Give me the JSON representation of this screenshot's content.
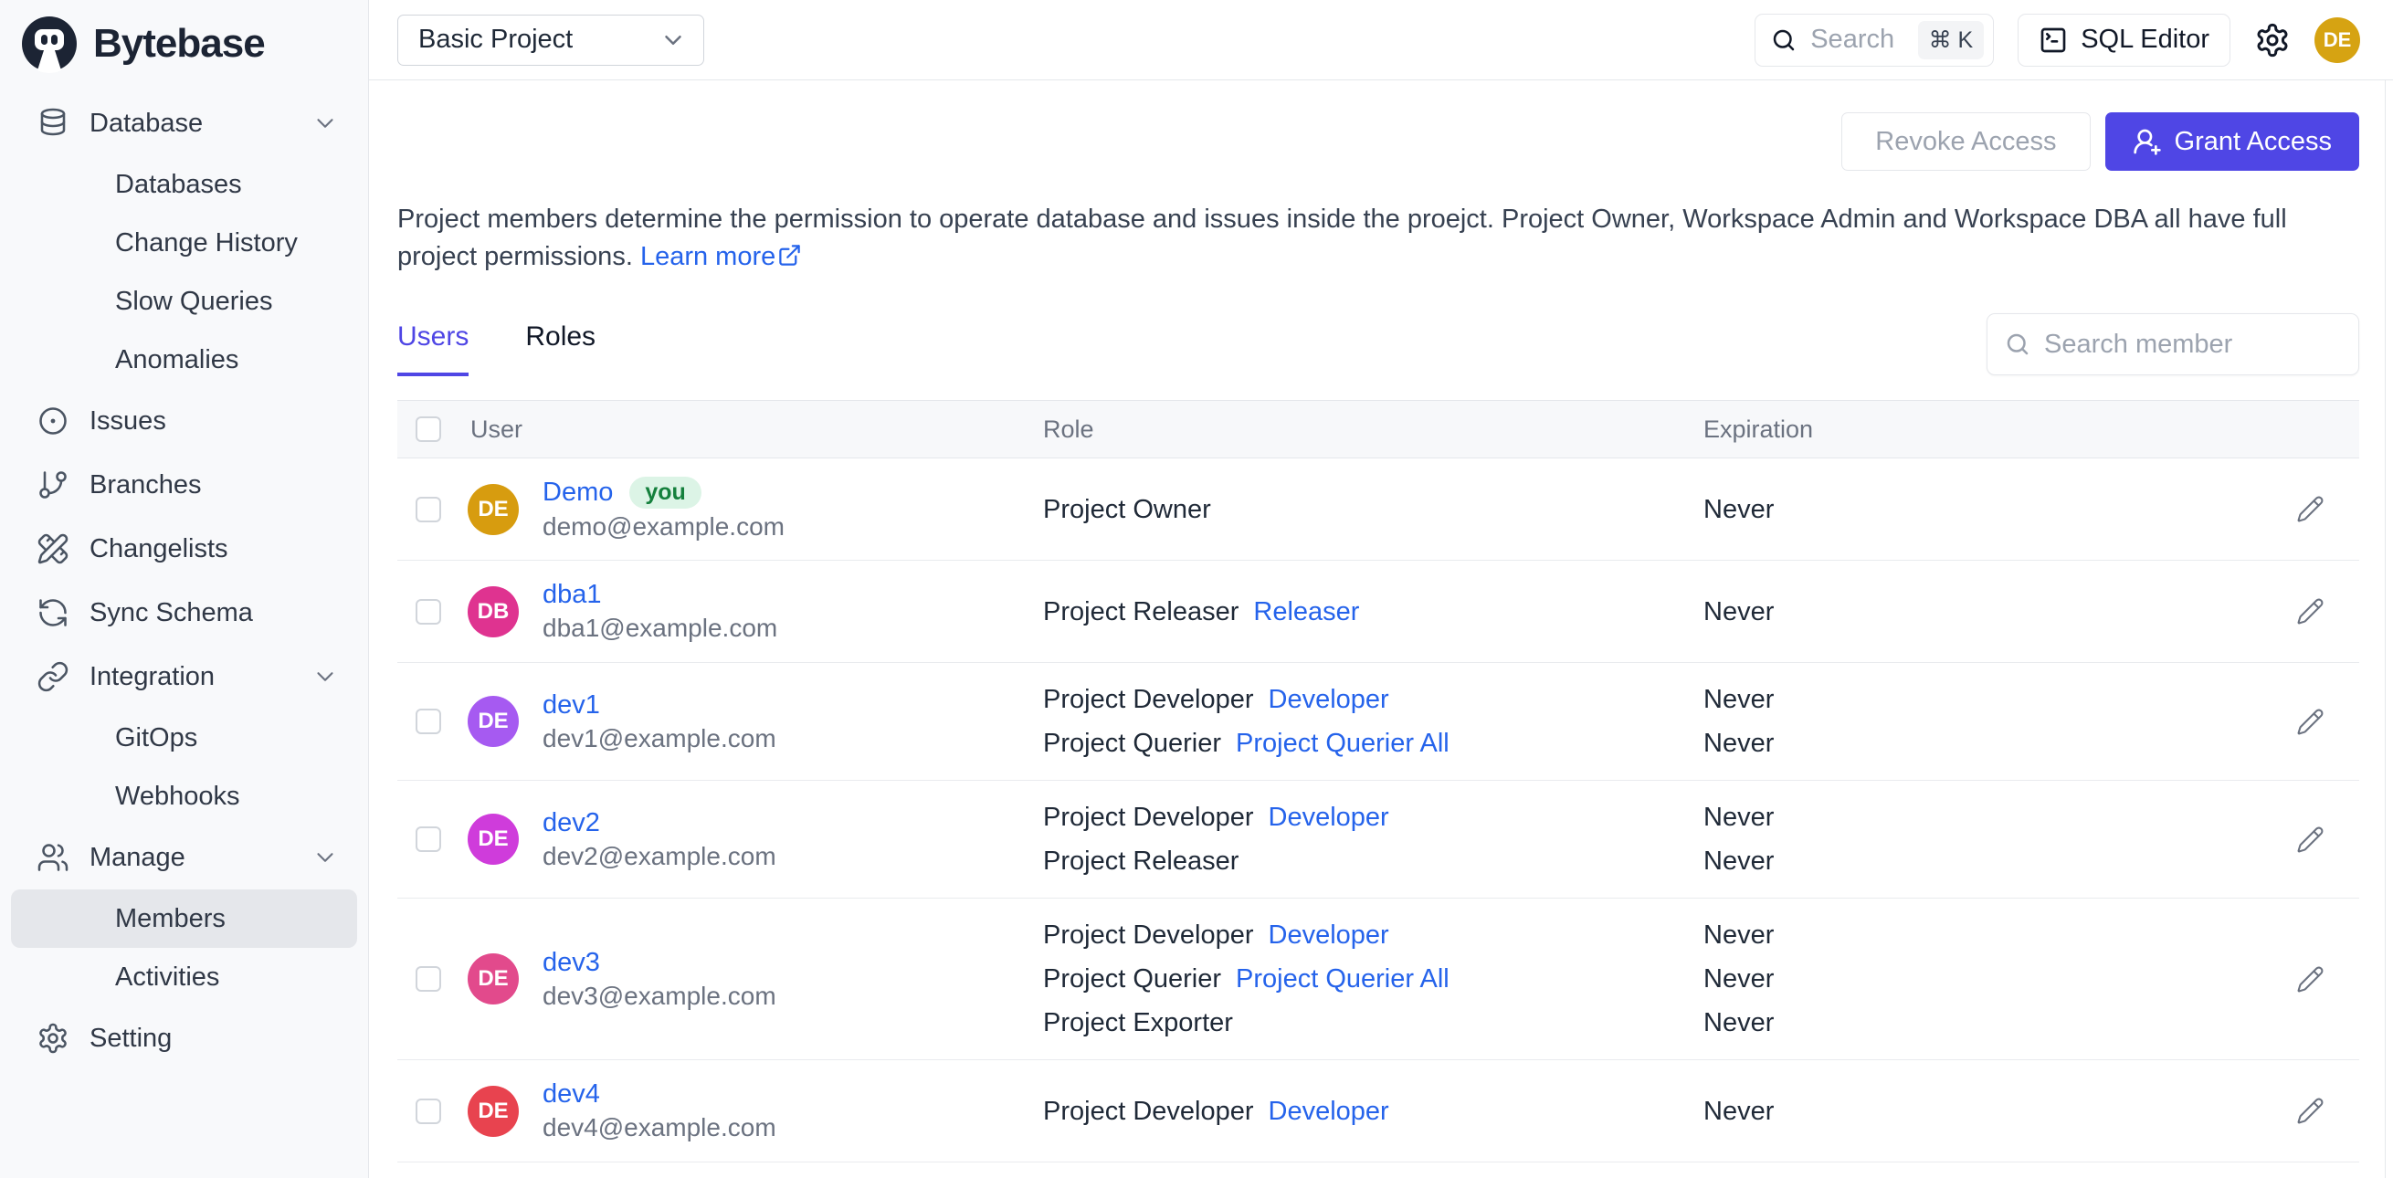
{
  "brand": {
    "name": "Bytebase"
  },
  "topbar": {
    "project_selector": {
      "value": "Basic Project"
    },
    "search": {
      "placeholder": "Search",
      "shortcut": "⌘ K"
    },
    "sql_editor_label": "SQL Editor",
    "user_avatar": {
      "initials": "DE",
      "color": "#D6A312"
    }
  },
  "sidebar": {
    "items": [
      {
        "label": "Database",
        "icon": "database-icon",
        "expandable": true
      },
      {
        "label": "Databases",
        "child": true
      },
      {
        "label": "Change History",
        "child": true
      },
      {
        "label": "Slow Queries",
        "child": true
      },
      {
        "label": "Anomalies",
        "child": true
      },
      {
        "label": "Issues",
        "icon": "issues-icon"
      },
      {
        "label": "Branches",
        "icon": "branch-icon"
      },
      {
        "label": "Changelists",
        "icon": "changelist-icon"
      },
      {
        "label": "Sync Schema",
        "icon": "sync-icon"
      },
      {
        "label": "Integration",
        "icon": "link-icon",
        "expandable": true
      },
      {
        "label": "GitOps",
        "child": true
      },
      {
        "label": "Webhooks",
        "child": true
      },
      {
        "label": "Manage",
        "icon": "users-icon",
        "expandable": true
      },
      {
        "label": "Members",
        "child": true,
        "active": true
      },
      {
        "label": "Activities",
        "child": true
      },
      {
        "label": "Setting",
        "icon": "gear-icon"
      }
    ]
  },
  "page": {
    "actions": {
      "revoke_label": "Revoke Access",
      "grant_label": "Grant Access"
    },
    "description": {
      "text": "Project members determine the permission to operate database and issues inside the proejct. Project Owner, Workspace Admin and Workspace DBA all have full project permissions.",
      "link_label": "Learn more"
    },
    "tabs": [
      {
        "label": "Users",
        "active": true
      },
      {
        "label": "Roles",
        "active": false
      }
    ],
    "member_search_placeholder": "Search member",
    "table": {
      "headers": [
        "User",
        "Role",
        "Expiration"
      ],
      "rows": [
        {
          "initials": "DE",
          "avatar_color": "#D79C0F",
          "name": "Demo",
          "you_badge": "you",
          "email": "demo@example.com",
          "roles": [
            {
              "role": "Project Owner",
              "link": "",
              "expiration": "Never"
            }
          ]
        },
        {
          "initials": "DB",
          "avatar_color": "#DF3390",
          "name": "dba1",
          "you_badge": "",
          "email": "dba1@example.com",
          "roles": [
            {
              "role": "Project Releaser",
              "link": "Releaser",
              "expiration": "Never"
            }
          ]
        },
        {
          "initials": "DE",
          "avatar_color": "#A65AF1",
          "name": "dev1",
          "you_badge": "",
          "email": "dev1@example.com",
          "roles": [
            {
              "role": "Project Developer",
              "link": "Developer",
              "expiration": "Never"
            },
            {
              "role": "Project Querier",
              "link": "Project Querier All",
              "expiration": "Never"
            }
          ]
        },
        {
          "initials": "DE",
          "avatar_color": "#CF3CDB",
          "name": "dev2",
          "you_badge": "",
          "email": "dev2@example.com",
          "roles": [
            {
              "role": "Project Developer",
              "link": "Developer",
              "expiration": "Never"
            },
            {
              "role": "Project Releaser",
              "link": "",
              "expiration": "Never"
            }
          ]
        },
        {
          "initials": "DE",
          "avatar_color": "#E24A8C",
          "name": "dev3",
          "you_badge": "",
          "email": "dev3@example.com",
          "roles": [
            {
              "role": "Project Developer",
              "link": "Developer",
              "expiration": "Never"
            },
            {
              "role": "Project Querier",
              "link": "Project Querier All",
              "expiration": "Never"
            },
            {
              "role": "Project Exporter",
              "link": "",
              "expiration": "Never"
            }
          ]
        },
        {
          "initials": "DE",
          "avatar_color": "#E8434F",
          "name": "dev4",
          "you_badge": "",
          "email": "dev4@example.com",
          "roles": [
            {
              "role": "Project Developer",
              "link": "Developer",
              "expiration": "Never"
            }
          ]
        }
      ]
    }
  },
  "colors": {
    "accent": "#4F46E5",
    "link": "#2563EB",
    "badge_bg": "#DCF4E6",
    "badge_text": "#15803D"
  }
}
